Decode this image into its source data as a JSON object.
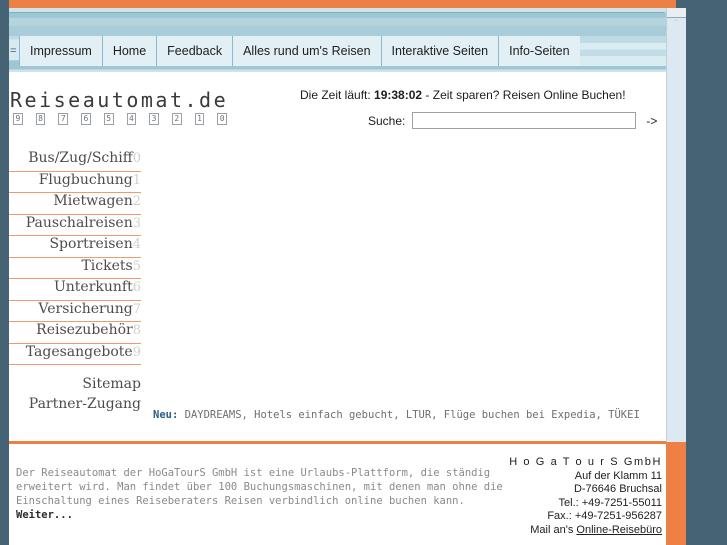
{
  "site": {
    "logo_text": "Reiseautomat.de",
    "digits": [
      "9",
      "8",
      "7",
      "6",
      "5",
      "4",
      "3",
      "2",
      "1",
      "0"
    ]
  },
  "colors": {
    "accent_orange": "#ee7f45",
    "frame_blue": "#456375",
    "nav_blue": "#d6eaf1",
    "rule_orange": "#ee9a73"
  },
  "nav": {
    "stub": "=",
    "items": [
      {
        "label": "Impressum"
      },
      {
        "label": "Home"
      },
      {
        "label": "Feedback"
      },
      {
        "label": "Alles rund um's Reisen"
      },
      {
        "label": "Interaktive Seiten"
      },
      {
        "label": "Info-Seiten"
      }
    ]
  },
  "header": {
    "time_prefix": "Die Zeit läuft: ",
    "time_value": "19:38:02",
    "time_suffix": " - Zeit sparen? Reisen Online Buchen!",
    "search_label": "Suche:",
    "search_value": "",
    "search_placeholder": "",
    "search_arrow": "->"
  },
  "sidebar": {
    "items": [
      {
        "label": "Bus/Zug/Schiff",
        "num": "0"
      },
      {
        "label": "Flugbuchung",
        "num": "1"
      },
      {
        "label": "Mietwagen",
        "num": "2"
      },
      {
        "label": "Pauschalreisen",
        "num": "3"
      },
      {
        "label": "Sportreisen",
        "num": "4"
      },
      {
        "label": "Tickets",
        "num": "5"
      },
      {
        "label": "Unterkunft",
        "num": "6"
      },
      {
        "label": "Versicherung",
        "num": "7"
      },
      {
        "label": "Reisezubehör",
        "num": "8"
      },
      {
        "label": "Tagesangebote",
        "num": "9"
      }
    ],
    "links": [
      {
        "label": "Sitemap"
      },
      {
        "label": "Partner-Zugang"
      }
    ]
  },
  "news": {
    "prefix": "Neu:",
    "text": " DAYDREAMS, Hotels einfach gebucht, LTUR, Flüge buchen bei Expedia, TÜKEI"
  },
  "footer": {
    "description": "Der Reiseautomat der HoGaTourS GmbH ist eine Urlaubs-Plattform, die ständig erweitert wird. Man findet über 100 Buchungsmaschinen, mit denen man ohne die Einschaltung eines Reiseberaters Reisen verbindlich online buchen kann. ",
    "more_link": "Weiter...",
    "company": "H o G a T o u r S GmbH",
    "street": "Auf der Klamm 11",
    "city": "D-76646 Bruchsal",
    "phone": "Tel.: +49-7251-55011",
    "fax": "Fax.: +49-7251-956287",
    "mail_prefix": "Mail an's ",
    "mail_link": "Online-Reisebüro"
  },
  "scrollbar": {
    "marks": "▫▫"
  }
}
